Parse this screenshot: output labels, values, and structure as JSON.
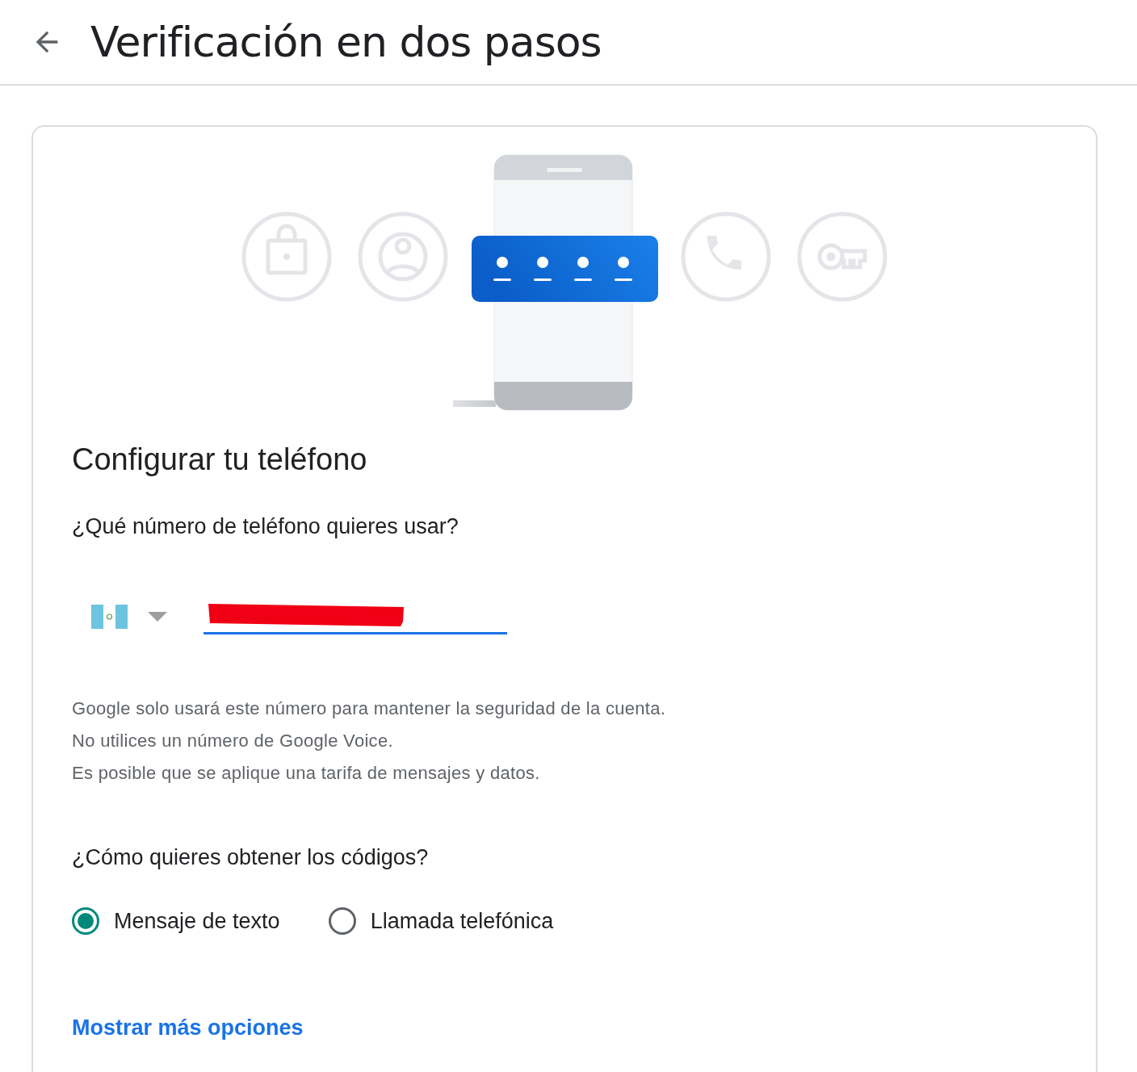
{
  "header": {
    "title": "Verificación en dos pasos"
  },
  "setup": {
    "heading": "Configurar tu teléfono",
    "question": "¿Qué número de teléfono quieres usar?",
    "phone_field": {
      "redacted": true
    },
    "help_lines": [
      "Google solo usará este número para mantener la seguridad de la cuenta.",
      "No utilices un número de Google Voice.",
      "Es posible que se aplique una tarifa de mensajes y datos."
    ],
    "codes_question": "¿Cómo quieres obtener los códigos?",
    "options": [
      {
        "label": "Mensaje de texto",
        "selected": true
      },
      {
        "label": "Llamada telefónica",
        "selected": false
      }
    ],
    "more_link": "Mostrar más opciones"
  }
}
